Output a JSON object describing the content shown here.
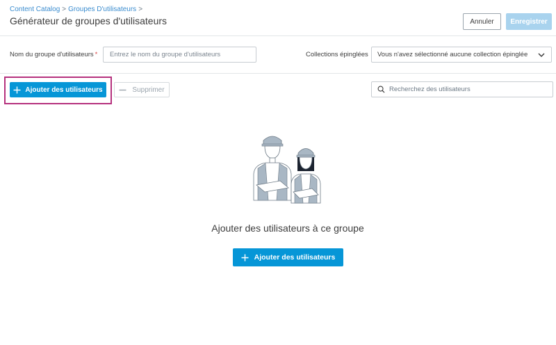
{
  "breadcrumb": {
    "items": [
      "Content Catalog",
      "Groupes D'utilisateurs"
    ],
    "separator": ">"
  },
  "header": {
    "title": "Générateur de groupes d'utilisateurs",
    "cancel_label": "Annuler",
    "save_label": "Enregistrer"
  },
  "form": {
    "name_label": "Nom du groupe d'utilisateurs",
    "required_mark": "*",
    "name_placeholder": "Entrez le nom du groupe d'utilisateurs",
    "collections_label": "Collections épinglées",
    "collections_value": "Vous n'avez sélectionné aucune collection épinglée"
  },
  "toolbar": {
    "add_icon": "plus",
    "add_label": "Ajouter des utilisateurs",
    "remove_icon": "minus",
    "remove_label": "Supprimer",
    "search_placeholder": "Recherchez des utilisateurs"
  },
  "empty_state": {
    "title": "Ajouter des utilisateurs à ce groupe",
    "add_icon": "plus",
    "add_label": "Ajouter des utilisateurs"
  },
  "colors": {
    "primary": "#0696d7",
    "primary_disabled": "#a9d3ee",
    "highlight": "#b5307d",
    "link": "#3a8ccf"
  }
}
